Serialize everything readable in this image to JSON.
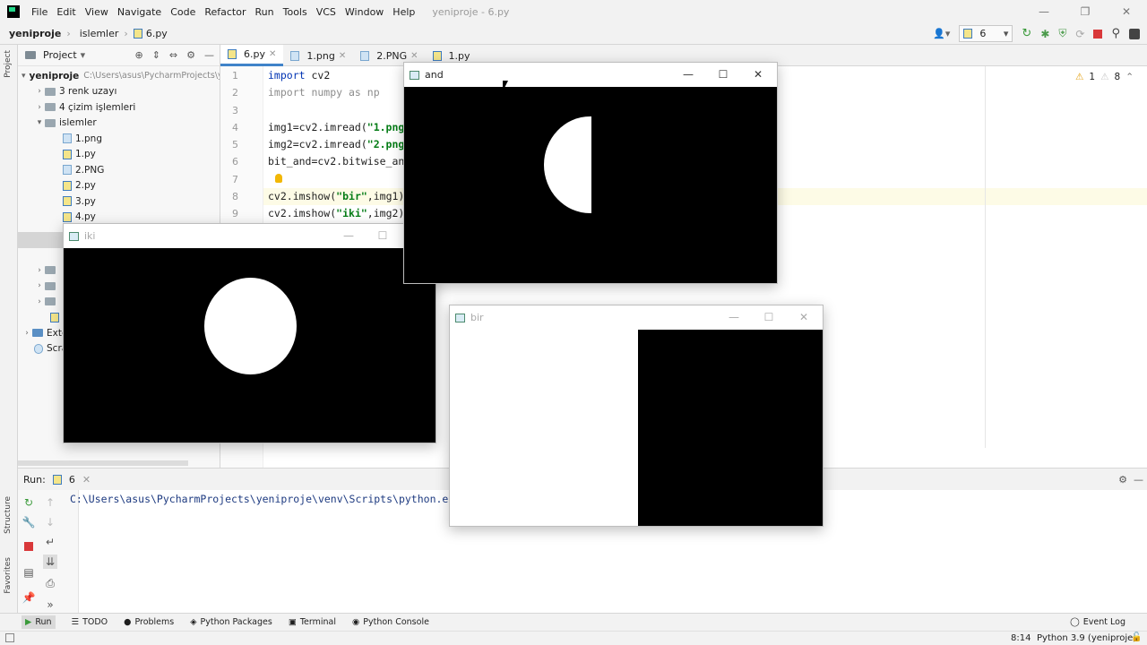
{
  "menubar": {
    "items": [
      "File",
      "Edit",
      "View",
      "Navigate",
      "Code",
      "Refactor",
      "Run",
      "Tools",
      "VCS",
      "Window",
      "Help"
    ],
    "window_title": "yeniproje - 6.py",
    "controls": {
      "minimize": "—",
      "maximize": "❐",
      "close": "✕"
    }
  },
  "navbar": {
    "breadcrumbs": [
      "yeniproje",
      "islemler",
      "6.py"
    ],
    "run_config": "6"
  },
  "project": {
    "title": "Project",
    "root_name": "yeniproje",
    "root_path": "C:\\Users\\asus\\PycharmProjects\\y",
    "items": [
      {
        "label": "3 renk uzayı"
      },
      {
        "label": "4 çizim işlemleri"
      },
      {
        "label": "islemler"
      },
      {
        "label": "1.png"
      },
      {
        "label": "1.py"
      },
      {
        "label": "2.PNG"
      },
      {
        "label": "2.py"
      },
      {
        "label": "3.py"
      },
      {
        "label": "4.py"
      },
      {
        "label": "Exte"
      },
      {
        "label": "Scra"
      }
    ]
  },
  "tabs": [
    {
      "label": "6.py"
    },
    {
      "label": "1.png"
    },
    {
      "label": "2.PNG"
    },
    {
      "label": "1.py"
    }
  ],
  "editor": {
    "line_numbers": [
      "1",
      "2",
      "3",
      "4",
      "5",
      "6",
      "7",
      "8",
      "9"
    ],
    "warnings": "1",
    "weak_warnings": "8"
  },
  "code": {
    "l1_kw": "import",
    "l1_rest": " cv2",
    "l2": "import numpy as np",
    "l4_a": "img1=cv2.imread(",
    "l4_s": "\"1.png\"",
    "l5_a": "img2=cv2.imread(",
    "l5_s": "\"2.png\"",
    "l6": "bit_and=cv2.bitwise_and",
    "l8_a": "cv2.imshow(",
    "l8_s": "\"bir\"",
    "l8_b": ",img1)",
    "l9_a": "cv2.imshow(",
    "l9_s": "\"iki\"",
    "l9_b": ",img2)"
  },
  "run": {
    "label": "Run:",
    "tab": "6",
    "output": "C:\\Users\\asus\\PycharmProjects\\yeniproje\\venv\\Scripts\\python.exe"
  },
  "bottom_tools": [
    "Run",
    "TODO",
    "Problems",
    "Python Packages",
    "Terminal",
    "Python Console"
  ],
  "event_log": "Event Log",
  "status": {
    "position": "8:14",
    "interpreter": "Python 3.9 (yeniproje)"
  },
  "side_labels": {
    "project": "Project",
    "structure": "Structure",
    "favorites": "Favorites"
  },
  "windows": {
    "and": {
      "title": "and"
    },
    "iki": {
      "title": "iki"
    },
    "bir": {
      "title": "bir"
    }
  }
}
